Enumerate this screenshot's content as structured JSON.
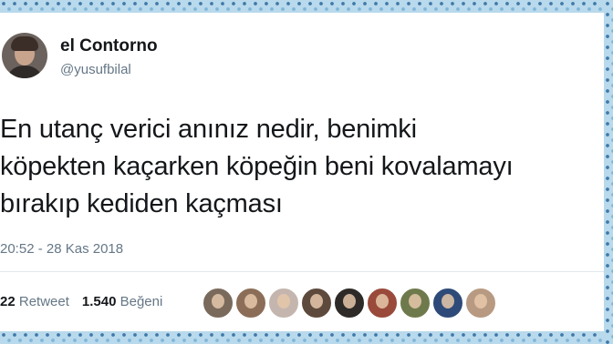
{
  "tweet": {
    "display_name": "el Contorno",
    "handle": "@yusufbilal",
    "text": "En utanç verici anınız nedir, benimki\nköpekten kaçarken köpeğin beni kovalamayı\nbırakıp kediden kaçması",
    "timestamp": "20:52 - 28 Kas 2018",
    "retweet_count": "22",
    "retweet_label": "Retweet",
    "like_count": "1.540",
    "like_label": "Beğeni"
  },
  "likers": [
    {
      "icon": "liker-avatar",
      "color": "#7a6a5c"
    },
    {
      "icon": "liker-avatar",
      "color": "#8c6e58"
    },
    {
      "icon": "liker-avatar",
      "color": "#c4b6ae"
    },
    {
      "icon": "liker-avatar",
      "color": "#5e4a3c"
    },
    {
      "icon": "liker-avatar",
      "color": "#2e2a28"
    },
    {
      "icon": "liker-avatar",
      "color": "#9a4a3a"
    },
    {
      "icon": "liker-avatar",
      "color": "#6f7a4c"
    },
    {
      "icon": "liker-avatar",
      "color": "#2e4a78"
    },
    {
      "icon": "liker-avatar",
      "color": "#b89a82"
    }
  ],
  "colors": {
    "frame": "#b9d9ec",
    "text_primary": "#14171a",
    "text_secondary": "#657786"
  }
}
